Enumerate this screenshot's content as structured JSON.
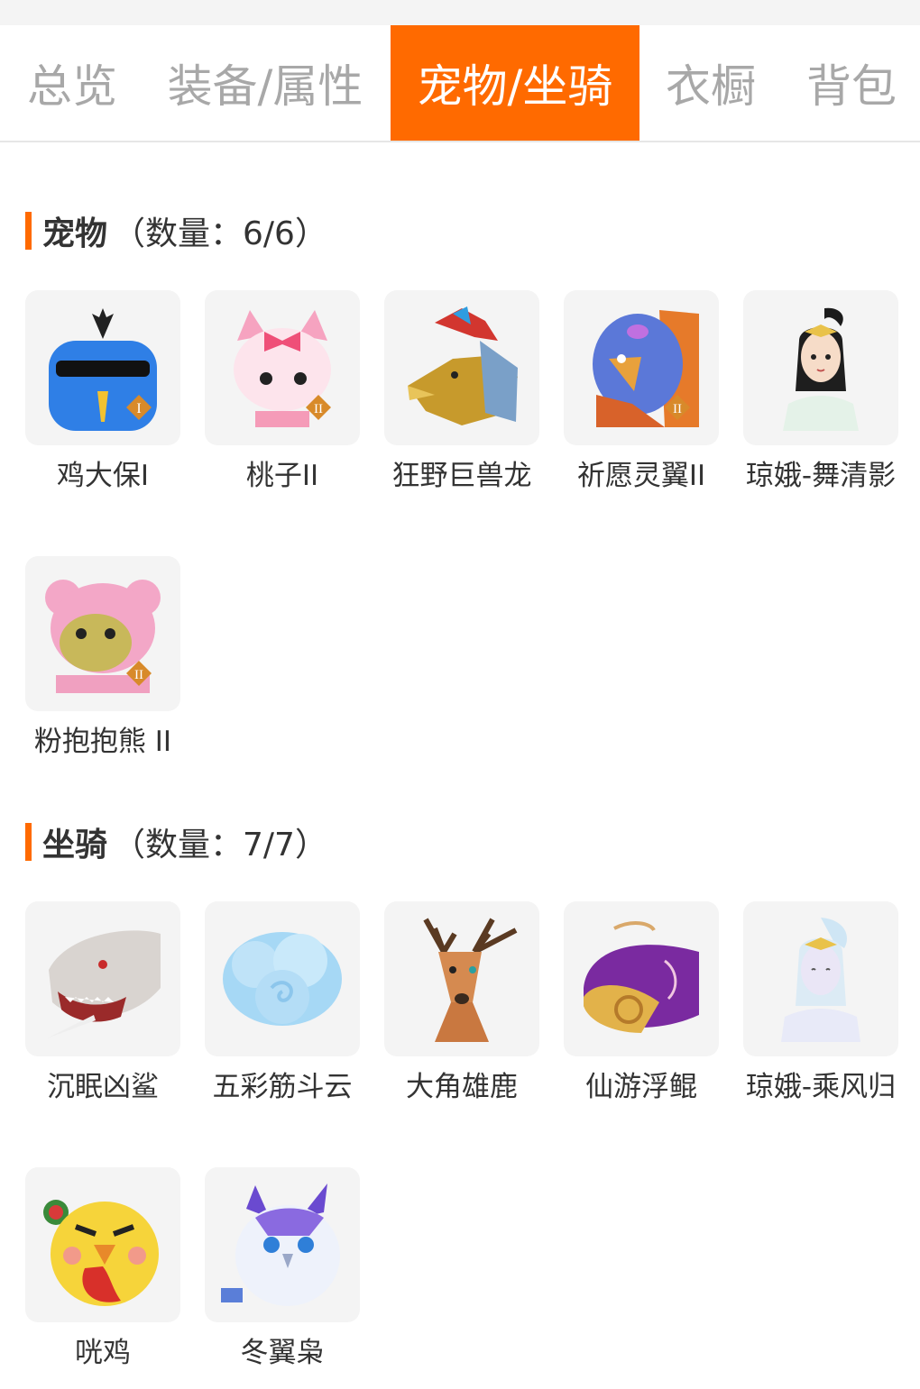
{
  "tabs": [
    {
      "label": "总览"
    },
    {
      "label": "装备/属性"
    },
    {
      "label": "宠物/坐骑"
    },
    {
      "label": "衣橱"
    },
    {
      "label": "背包"
    }
  ],
  "active_tab": "宠物/坐骑",
  "accent_color": "#ff6a00",
  "pets": {
    "title": "宠物",
    "count": "（数量：6/6）",
    "items": [
      {
        "name": "鸡大保I",
        "icon": "blue-chick-icon",
        "badge": "I"
      },
      {
        "name": "桃子II",
        "icon": "pink-cat-icon",
        "badge": "II"
      },
      {
        "name": "狂野巨兽龙",
        "icon": "dragon-icon",
        "badge": ""
      },
      {
        "name": "祈愿灵翼II",
        "icon": "eagle-icon",
        "badge": "II"
      },
      {
        "name": "琼娥-舞清影",
        "icon": "maiden-icon",
        "badge": ""
      },
      {
        "name": "粉抱抱熊 II",
        "icon": "pink-bear-icon",
        "badge": "II"
      }
    ]
  },
  "mounts": {
    "title": "坐骑",
    "count": "（数量：7/7）",
    "items": [
      {
        "name": "沉眠凶鲨",
        "icon": "shark-icon"
      },
      {
        "name": "五彩筋斗云",
        "icon": "cloud-icon"
      },
      {
        "name": "大角雄鹿",
        "icon": "deer-icon"
      },
      {
        "name": "仙游浮鲲",
        "icon": "whale-icon"
      },
      {
        "name": "琼娥-乘风归",
        "icon": "maiden-icon"
      },
      {
        "name": "咣鸡",
        "icon": "yellow-chick-icon"
      },
      {
        "name": "冬翼枭",
        "icon": "owl-icon"
      }
    ]
  }
}
